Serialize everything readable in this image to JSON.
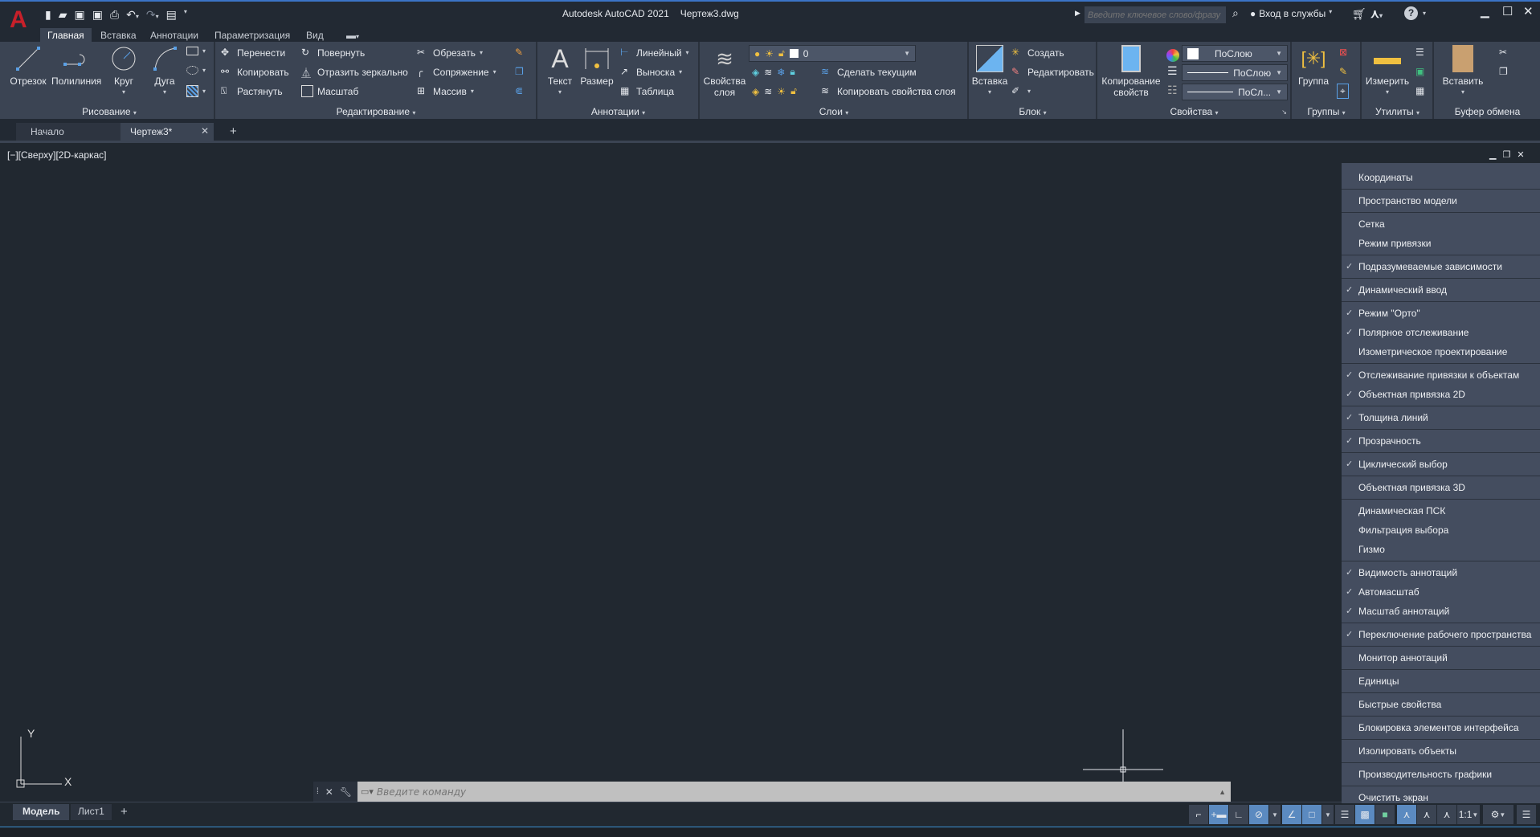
{
  "titlebar": {
    "app": "Autodesk AutoCAD 2021",
    "file": "Чертеж3.dwg",
    "search_placeholder": "Введите ключевое слово/фразу",
    "signin": "Вход в службы"
  },
  "ribbon_tabs": [
    "Главная",
    "Вставка",
    "Аннотации",
    "Параметризация",
    "Вид"
  ],
  "panels": {
    "draw": {
      "title": "Рисование",
      "line": "Отрезок",
      "pline": "Полилиния",
      "circle": "Круг",
      "arc": "Дуга"
    },
    "modify": {
      "title": "Редактирование",
      "move": "Перенести",
      "copy": "Копировать",
      "stretch": "Растянуть",
      "rotate": "Повернуть",
      "mirror": "Отразить зеркально",
      "scale": "Масштаб",
      "trim": "Обрезать",
      "fillet": "Сопряжение",
      "array": "Массив"
    },
    "annot": {
      "title": "Аннотации",
      "text": "Текст",
      "dim": "Размер",
      "linear": "Линейный",
      "leader": "Выноска",
      "table": "Таблица"
    },
    "layers": {
      "title": "Слои",
      "props": "Свойства слоя",
      "current_layer": "0",
      "make_current": "Сделать текущим",
      "match_layer": "Копировать свойства слоя"
    },
    "block": {
      "title": "Блок",
      "insert": "Вставка",
      "create": "Создать",
      "edit": "Редактировать"
    },
    "props": {
      "title": "Свойства",
      "match": "Копирование свойств",
      "color": "ПоСлою",
      "lineweight": "ПоСлою",
      "linetype": "ПоСл..."
    },
    "groups": {
      "title": "Группы",
      "group": "Группа"
    },
    "utils": {
      "title": "Утилиты",
      "measure": "Измерить"
    },
    "clipboard": {
      "title": "Буфер обмена",
      "paste": "Вставить"
    }
  },
  "file_tabs": {
    "start": "Начало",
    "drawing": "Чертеж3*"
  },
  "viewport": {
    "label": "[−][Сверху][2D-каркас]",
    "ucs_x": "X",
    "ucs_y": "Y"
  },
  "command": {
    "placeholder": "Введите команду"
  },
  "layout_tabs": [
    "Модель",
    "Лист1"
  ],
  "status": {
    "scale": "1:1"
  },
  "menu": [
    {
      "label": "Координаты",
      "checked": false,
      "sep": true
    },
    {
      "label": "Пространство модели",
      "checked": false,
      "sep": true
    },
    {
      "label": "Сетка",
      "checked": false
    },
    {
      "label": "Режим привязки",
      "checked": false,
      "sep": true
    },
    {
      "label": "Подразумеваемые зависимости",
      "checked": true,
      "sep": true
    },
    {
      "label": "Динамический ввод",
      "checked": true,
      "sep": true
    },
    {
      "label": "Режим \"Орто\"",
      "checked": true
    },
    {
      "label": "Полярное отслеживание",
      "checked": true
    },
    {
      "label": "Изометрическое проектирование",
      "checked": false,
      "sep": true
    },
    {
      "label": "Отслеживание привязки к объектам",
      "checked": true
    },
    {
      "label": "Объектная привязка 2D",
      "checked": true,
      "sep": true
    },
    {
      "label": "Толщина линий",
      "checked": true,
      "sep": true
    },
    {
      "label": "Прозрачность",
      "checked": true,
      "sep": true
    },
    {
      "label": "Циклический выбор",
      "checked": true,
      "sep": true
    },
    {
      "label": "Объектная привязка 3D",
      "checked": false,
      "sep": true
    },
    {
      "label": "Динамическая ПСК",
      "checked": false
    },
    {
      "label": "Фильтрация выбора",
      "checked": false
    },
    {
      "label": "Гизмо",
      "checked": false,
      "sep": true
    },
    {
      "label": "Видимость аннотаций",
      "checked": true
    },
    {
      "label": "Автомасштаб",
      "checked": true
    },
    {
      "label": "Масштаб аннотаций",
      "checked": true,
      "sep": true
    },
    {
      "label": "Переключение рабочего пространства",
      "checked": true,
      "sep": true
    },
    {
      "label": "Монитор аннотаций",
      "checked": false,
      "sep": true
    },
    {
      "label": "Единицы",
      "checked": false,
      "sep": true
    },
    {
      "label": "Быстрые свойства",
      "checked": false,
      "sep": true
    },
    {
      "label": "Блокировка элементов интерфейса",
      "checked": false,
      "sep": true
    },
    {
      "label": "Изолировать объекты",
      "checked": false,
      "sep": true
    },
    {
      "label": "Производительность графики",
      "checked": false,
      "sep": true
    },
    {
      "label": "Очистить экран",
      "checked": false
    }
  ],
  "colors": {
    "accent": "#5b8ac0",
    "logo": "#c8202a",
    "panel": "#3b4453",
    "bg": "#212830"
  }
}
